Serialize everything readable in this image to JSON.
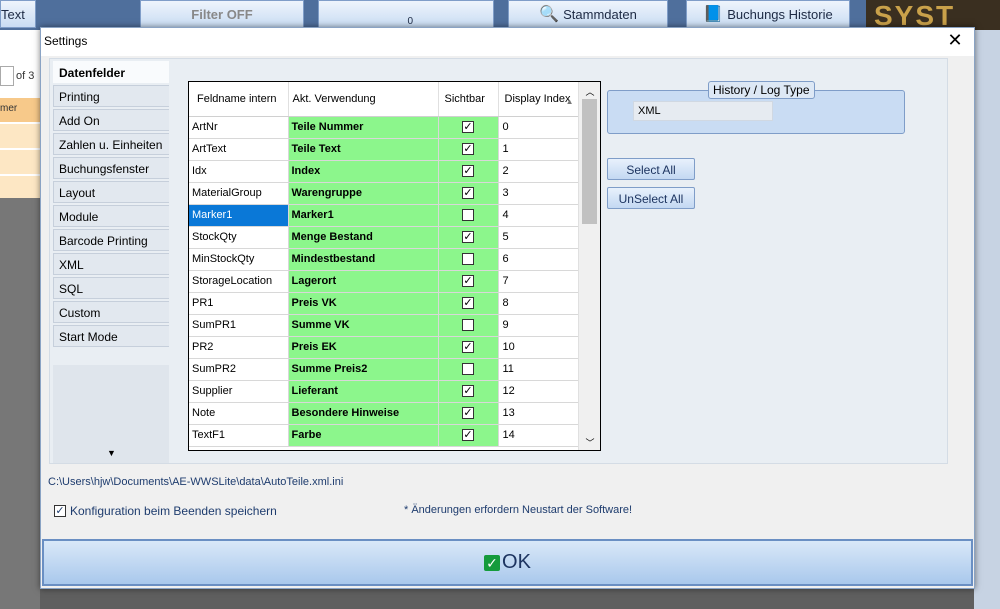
{
  "background": {
    "top_buttons": [
      {
        "label": "Text"
      },
      {
        "label": "Filter OFF"
      },
      {
        "label": "0"
      },
      {
        "label": "Stammdaten"
      },
      {
        "label": "Buchungs Historie"
      }
    ],
    "logo": "SYST",
    "pager_of": "of 3",
    "column_fragment": "mer"
  },
  "dialog": {
    "title": "Settings",
    "close_label": "✕",
    "tabs": [
      {
        "label": "Datenfelder",
        "active": true
      },
      {
        "label": "Printing"
      },
      {
        "label": "Add On"
      },
      {
        "label": "Zahlen u. Einheiten"
      },
      {
        "label": "Buchungsfenster"
      },
      {
        "label": "Layout"
      },
      {
        "label": "Module"
      },
      {
        "label": "Barcode Printing"
      },
      {
        "label": "XML"
      },
      {
        "label": "SQL"
      },
      {
        "label": "Custom"
      },
      {
        "label": "Start Mode"
      }
    ],
    "grid": {
      "headers": {
        "fieldname": "Feldname intern",
        "usage": "Akt. Verwendung",
        "visible": "Sichtbar",
        "index": "Display Index"
      },
      "rows": [
        {
          "field": "ArtNr",
          "usage": "Teile Nummer",
          "visible": true,
          "index": "0"
        },
        {
          "field": "ArtText",
          "usage": "Teile Text",
          "visible": true,
          "index": "1"
        },
        {
          "field": "Idx",
          "usage": "Index",
          "visible": true,
          "index": "2"
        },
        {
          "field": "MaterialGroup",
          "usage": "Warengruppe",
          "visible": true,
          "index": "3"
        },
        {
          "field": "Marker1",
          "usage": "Marker1",
          "visible": false,
          "index": "4",
          "selected": true
        },
        {
          "field": "StockQty",
          "usage": "Menge Bestand",
          "visible": true,
          "index": "5"
        },
        {
          "field": "MinStockQty",
          "usage": "Mindestbestand",
          "visible": false,
          "index": "6"
        },
        {
          "field": "StorageLocation",
          "usage": "Lagerort",
          "visible": true,
          "index": "7"
        },
        {
          "field": "PR1",
          "usage": "Preis VK",
          "visible": true,
          "index": "8"
        },
        {
          "field": "SumPR1",
          "usage": "Summe VK",
          "visible": false,
          "index": "9"
        },
        {
          "field": "PR2",
          "usage": "Preis EK",
          "visible": true,
          "index": "10"
        },
        {
          "field": "SumPR2",
          "usage": "Summe Preis2",
          "visible": false,
          "index": "11"
        },
        {
          "field": "Supplier",
          "usage": "Lieferant",
          "visible": true,
          "index": "12"
        },
        {
          "field": "Note",
          "usage": "Besondere Hinweise",
          "visible": true,
          "index": "13"
        },
        {
          "field": "TextF1",
          "usage": "Farbe",
          "visible": true,
          "index": "14"
        }
      ]
    },
    "history": {
      "label": "History / Log Type",
      "value": "XML"
    },
    "select_all_label": "Select All",
    "unselect_all_label": "UnSelect All",
    "config_path": "C:\\Users\\hjw\\Documents\\AE-WWSLite\\data\\AutoTeile.xml.ini",
    "save_on_exit_label": "Konfiguration beim Beenden speichern",
    "save_on_exit_checked": true,
    "restart_note": "* Änderungen erfordern Neustart der Software!",
    "ok_label": "OK"
  },
  "colors": {
    "usage_bg": "#8cf68c",
    "selected_bg": "#0a78d7",
    "accent": "#7f9dc8"
  }
}
